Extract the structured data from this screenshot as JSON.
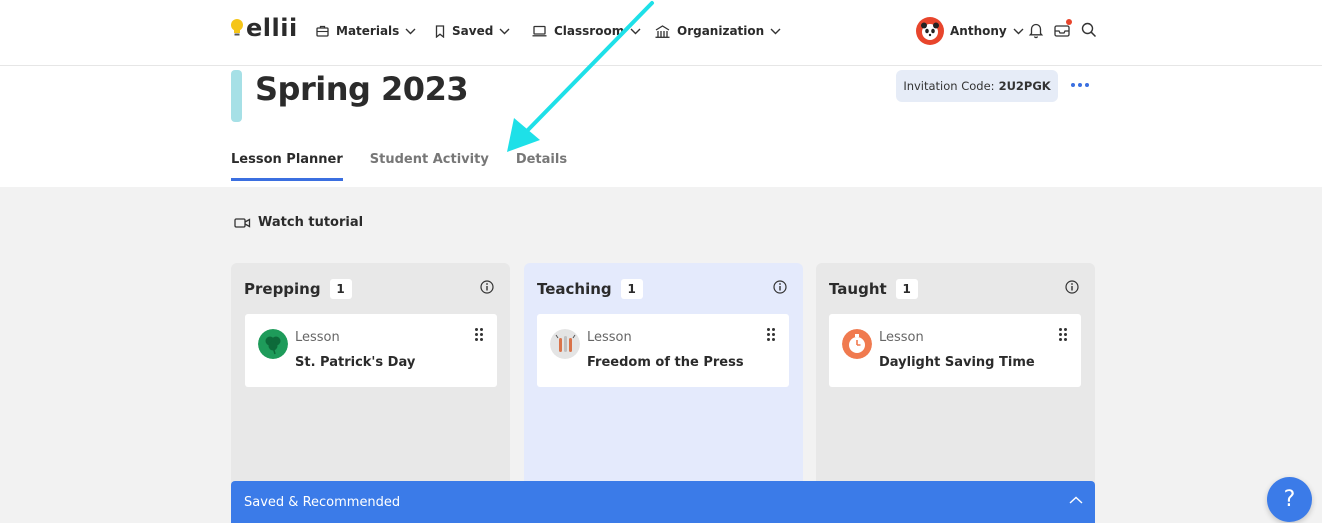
{
  "app": {
    "logo_text": "ellii"
  },
  "nav": {
    "materials": "Materials",
    "saved": "Saved",
    "classroom": "Classroom",
    "organization": "Organization"
  },
  "user": {
    "name": "Anthony"
  },
  "page": {
    "title": "Spring 2023",
    "invitation_label": "Invitation Code:",
    "invitation_code": "2U2PGK"
  },
  "tabs": [
    {
      "label": "Lesson Planner",
      "active": true
    },
    {
      "label": "Student Activity",
      "active": false
    },
    {
      "label": "Details",
      "active": false
    }
  ],
  "tutorial": {
    "label": "Watch tutorial"
  },
  "columns": [
    {
      "title": "Prepping",
      "count": "1",
      "card": {
        "type": "Lesson",
        "title": "St. Patrick's Day",
        "icon": "shamrock-icon"
      }
    },
    {
      "title": "Teaching",
      "count": "1",
      "card": {
        "type": "Lesson",
        "title": "Freedom of the Press",
        "icon": "press-icon"
      }
    },
    {
      "title": "Taught",
      "count": "1",
      "card": {
        "type": "Lesson",
        "title": "Daylight Saving Time",
        "icon": "clock-icon"
      }
    }
  ],
  "saved_bar": {
    "label": "Saved & Recommended"
  },
  "help": {
    "label": "?"
  },
  "colors": {
    "accent": "#3b7be8",
    "teaching_bg": "#e4eafc",
    "title_bar": "#a6e0e6",
    "annotation_arrow": "#1ee0e8"
  }
}
